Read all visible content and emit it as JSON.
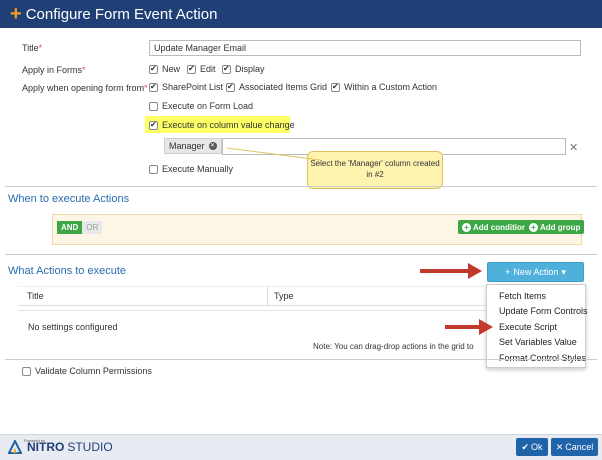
{
  "header": {
    "title": "Configure Form Event Action",
    "icon": "plus-icon"
  },
  "form": {
    "title_label": "Title",
    "title_value": "Update Manager Email",
    "apply_in_forms_label": "Apply in Forms",
    "forms": [
      {
        "label": "New",
        "checked": true
      },
      {
        "label": "Edit",
        "checked": true
      },
      {
        "label": "Display",
        "checked": true
      }
    ],
    "apply_when_label": "Apply when opening form from",
    "sources": [
      {
        "label": "SharePoint List",
        "checked": true
      },
      {
        "label": "Associated Items Grid",
        "checked": true
      },
      {
        "label": "Within a Custom Action",
        "checked": true
      }
    ],
    "execute_on_load": {
      "label": "Execute on Form Load",
      "checked": false
    },
    "execute_on_change": {
      "label": "Execute on column value change",
      "checked": true
    },
    "column_tag": "Manager",
    "execute_manually": {
      "label": "Execute Manually",
      "checked": false
    }
  },
  "callout": {
    "text": "Select the 'Manager' column created in #2"
  },
  "when_section": {
    "title": "When to execute Actions",
    "and_label": "AND",
    "or_label": "OR",
    "add_condition": "Add condition",
    "add_group": "Add group"
  },
  "actions_section": {
    "title": "What Actions to execute",
    "new_action": "New Action",
    "columns": [
      "Title",
      "Type"
    ],
    "empty_text": "No settings configured",
    "note": "Note: You can drag-drop actions in the grid to",
    "menu": [
      "Fetch Items",
      "Update Form Controls",
      "Execute Script",
      "Set Variables Value",
      "Format Control Styles"
    ]
  },
  "validate": {
    "label": "Validate Column Permissions",
    "checked": false
  },
  "footer": {
    "powered_by": "Powered by",
    "brand_bold": "NITRO",
    "brand_light": "STUDIO",
    "ok": "Ok",
    "cancel": "Cancel"
  },
  "colors": {
    "header": "#1f3f76",
    "accent": "#f3a21b",
    "green": "#3ca744",
    "blue_button": "#4fb0db",
    "arrow": "#c0392b",
    "highlight": "#ffff66"
  }
}
